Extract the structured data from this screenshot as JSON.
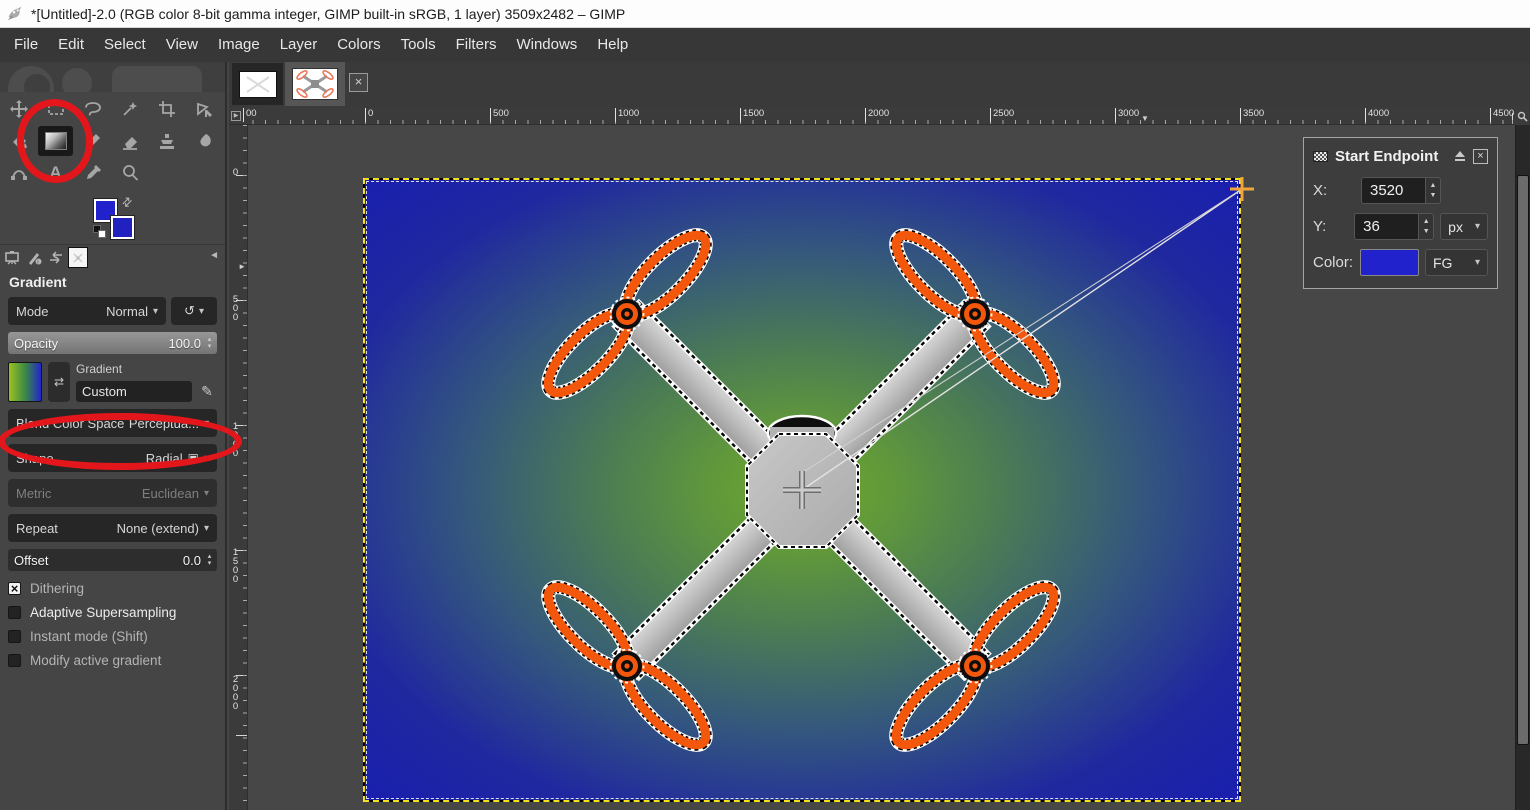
{
  "window": {
    "title": "*[Untitled]-2.0 (RGB color 8-bit gamma integer, GIMP built-in sRGB, 1 layer) 3509x2482 – GIMP"
  },
  "menu": {
    "items": [
      "File",
      "Edit",
      "Select",
      "View",
      "Image",
      "Layer",
      "Colors",
      "Tools",
      "Filters",
      "Windows",
      "Help"
    ]
  },
  "toolbox": {
    "tools": [
      "move",
      "rectangle-select",
      "free-select",
      "fuzzy-select",
      "crop",
      "unified-transform",
      "bucket-fill",
      "gradient",
      "pencil",
      "eraser",
      "clone",
      "smudge",
      "paths",
      "text",
      "color-picker",
      "zoom"
    ],
    "active_tool": "gradient",
    "foreground_color": "#2222cc",
    "background_color": "#2121c0"
  },
  "tool_options": {
    "title": "Gradient",
    "mode_label": "Mode",
    "mode_value": "Normal",
    "opacity_label": "Opacity",
    "opacity_value": "100.0",
    "gradient_label": "Gradient",
    "gradient_value": "Custom",
    "gradient_preview_colors": [
      "#9cc121",
      "#3d8a44",
      "#2227c8"
    ],
    "blend_label": "Blend Color Space",
    "blend_value": "Perceptua...",
    "shape_label": "Shape",
    "shape_value": "Radial",
    "metric_label": "Metric",
    "metric_value": "Euclidean",
    "repeat_label": "Repeat",
    "repeat_value": "None (extend)",
    "offset_label": "Offset",
    "offset_value": "0.0",
    "checkboxes": [
      {
        "label": "Dithering",
        "checked": true
      },
      {
        "label": "Adaptive Supersampling",
        "checked": false
      },
      {
        "label": "Instant mode  (Shift)",
        "checked": false
      },
      {
        "label": "Modify active gradient",
        "checked": false
      }
    ]
  },
  "rulers": {
    "horizontal_labels": [
      "00",
      "0",
      "500",
      "1000",
      "1500",
      "2000",
      "2500",
      "3000",
      "3500",
      "4000",
      "4500"
    ],
    "vertical_labels": [
      "0",
      "500",
      "1000",
      "1500",
      "2000"
    ]
  },
  "endpoint_dialog": {
    "title": "Start Endpoint",
    "x_label": "X:",
    "x_value": "3520",
    "y_label": "Y:",
    "y_value": "36",
    "unit_value": "px",
    "color_label": "Color:",
    "color_mode": "FG",
    "swatch_color": "#2222cc"
  },
  "canvas": {
    "gradient_center_color": "#6da62c",
    "gradient_edge_color": "#1b20ad",
    "propeller_color": "#f2570b",
    "body_color": "#bcbcbc",
    "layer_boundary_color": "#f4e11c"
  },
  "annotations": {
    "color": "#e3171b"
  }
}
